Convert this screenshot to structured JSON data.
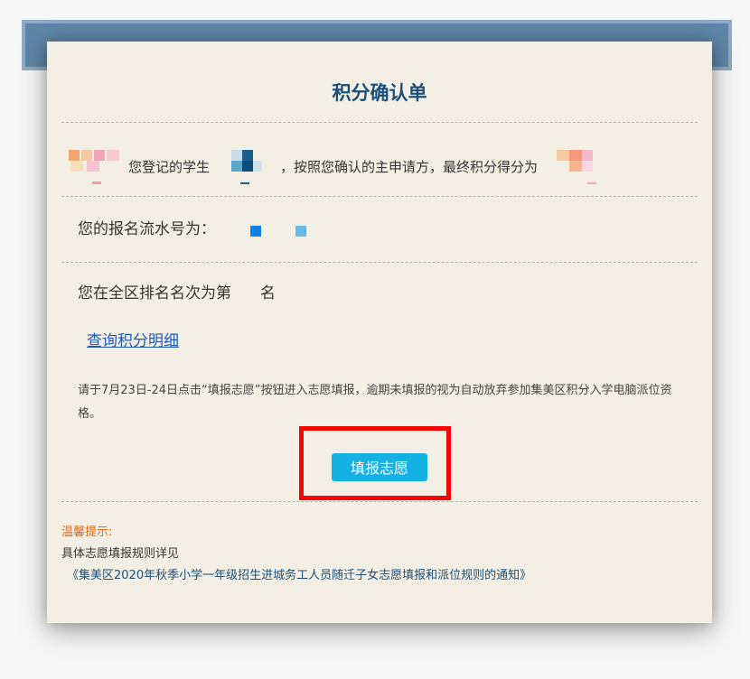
{
  "title": "积分确认单",
  "student_line": {
    "part1": "您登记的学生",
    "part2": "，按照您确认的主申请方，最终积分得分为"
  },
  "serial_line": "您的报名流水号为：",
  "rank_line": {
    "prefix": "您在全区排名名次为第",
    "suffix": "名"
  },
  "detail_link": "查询积分明细",
  "notice": "请于7月23日-24日点击“填报志愿”按钮进入志愿填报，逾期未填报的视为自动放弃参加集美区积分入学电脑派位资格。",
  "submit_button": "填报志愿",
  "tips": {
    "label": "温馨提示:",
    "line": "具体志愿填报规则详见",
    "link": "《集美区2020年秋季小学一年级招生进城务工人员随迁子女志愿填报和派位规则的通知》"
  },
  "colors": {
    "title": "#1b4f78",
    "button": "#13b0e3",
    "highlight": "#ff0000",
    "tip_label": "#e0681c",
    "link": "#2158b8"
  }
}
